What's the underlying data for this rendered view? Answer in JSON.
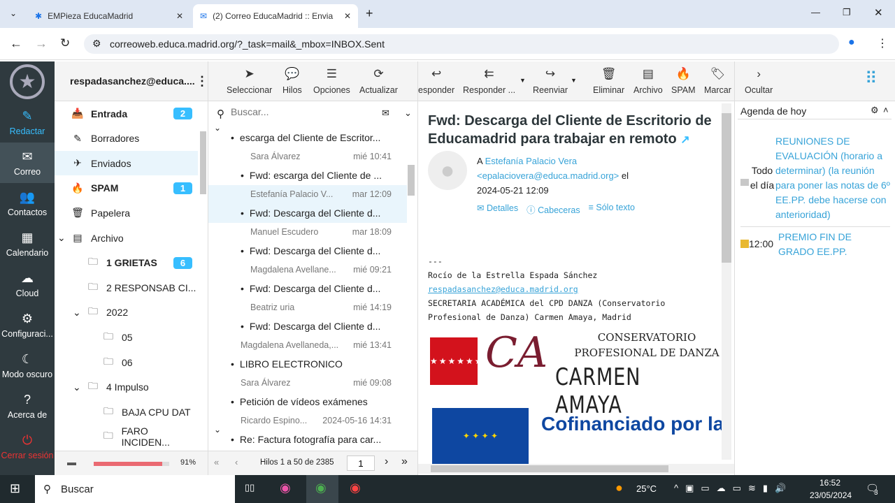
{
  "browser": {
    "tabs": [
      {
        "label": "EMPieza EducaMadrid"
      },
      {
        "label": "(2) Correo EducaMadrid :: Envia"
      }
    ],
    "url": "correoweb.educa.madrid.org/?_task=mail&_mbox=INBOX.Sent"
  },
  "nav": {
    "items": [
      "Redactar",
      "Correo",
      "Contactos",
      "Calendario",
      "Cloud",
      "Configuraci...",
      "Modo oscuro",
      "Acerca de",
      "Cerrar sesión"
    ]
  },
  "account": "respadasanchez@educa....",
  "folders": [
    {
      "label": "Entrada",
      "badge": "2",
      "bold": true
    },
    {
      "label": "Borradores"
    },
    {
      "label": "Enviados"
    },
    {
      "label": "SPAM",
      "badge": "1",
      "bold": true
    },
    {
      "label": "Papelera"
    },
    {
      "label": "Archivo"
    },
    {
      "label": "1 GRIETAS",
      "badge": "6",
      "bold": true
    },
    {
      "label": "2 RESPONSAB CI..."
    },
    {
      "label": "2022"
    },
    {
      "label": "05"
    },
    {
      "label": "06"
    },
    {
      "label": "4 Impulso"
    },
    {
      "label": "BAJA CPU DAT"
    },
    {
      "label": "FARO INCIDEN..."
    }
  ],
  "quota": "91%",
  "list_toolbar": [
    "Seleccionar",
    "Hilos",
    "Opciones",
    "Actualizar"
  ],
  "search_placeholder": "Buscar...",
  "messages": [
    {
      "from": "",
      "date": "",
      "subject": "escarga del Cliente de Escritor..."
    },
    {
      "from": "Sara Álvarez",
      "date": "mié 10:41",
      "subject": "Fwd: escarga del Cliente de ..."
    },
    {
      "from": "Estefanía Palacio V...",
      "date": "mar 12:09",
      "subject": "Fwd: Descarga del Cliente d..."
    },
    {
      "from": "Manuel Escudero",
      "date": "mar 18:09",
      "subject": "Fwd: Descarga del Cliente d..."
    },
    {
      "from": "Magdalena Avellane...",
      "date": "mié 09:21",
      "subject": "Fwd: Descarga del Cliente d..."
    },
    {
      "from": "Beatriz uria",
      "date": "mié 14:19",
      "subject": "Fwd: Descarga del Cliente d..."
    },
    {
      "from": "Magdalena Avellaneda,...",
      "date": "mié 13:41",
      "subject": "LIBRO ELECTRONICO"
    },
    {
      "from": "Sara Álvarez",
      "date": "mié 09:08",
      "subject": "Petición de vídeos exámenes"
    },
    {
      "from": "Ricardo Espino...",
      "date": "2024-05-16 14:31",
      "subject": "Re: Factura fotografía para car..."
    }
  ],
  "pagination": {
    "text": "Hilos 1 a 50 de 2385",
    "page": "1"
  },
  "msg_toolbar": [
    "esponder",
    "Responder ...",
    "Reenviar",
    "Eliminar",
    "Archivo",
    "SPAM",
    "Marcar",
    "Ocultar"
  ],
  "message": {
    "title": "Fwd: Descarga del Cliente de Escritorio de Educamadrid para trabajar en remoto",
    "to_prefix": "A",
    "to_name": "Estefanía Palacio Vera",
    "to_email": "<epalaciovera@educa.madrid.org>",
    "el": "el",
    "date": "2024-05-21 12:09",
    "actions": [
      "Detalles",
      "Cabeceras",
      "Sólo texto"
    ],
    "body": [
      "---",
      "Rocío de la Estrella Espada Sánchez",
      "respadasanchez@educa.madrid.org",
      "SECRETARIA ACADÉMICA del CPD DANZA (Conservatorio",
      "Profesional de Danza) Carmen Amaya, Madrid"
    ],
    "logo1": "CONSERVATORIO PROFESIONAL DE DANZA",
    "logo2": "CARMEN AMAYA",
    "logo3": "Cofinanciado por la Unión Europea"
  },
  "agenda": {
    "title": "Agenda de hoy",
    "events": [
      {
        "time": "Todo el día",
        "title": "REUNIONES DE EVALUACIÓN (horario a determinar) (la reunión para poner las notas de 6º EE.PP. debe hacerse con anterioridad)",
        "color": "#c8c8c8"
      },
      {
        "time": "12:00",
        "title": "PREMIO FIN DE GRADO EE.PP.",
        "color": "#e8b830"
      }
    ]
  },
  "taskbar": {
    "search": "Buscar",
    "temp": "25°C",
    "time": "16:52",
    "date": "23/05/2024",
    "notif": "3"
  }
}
